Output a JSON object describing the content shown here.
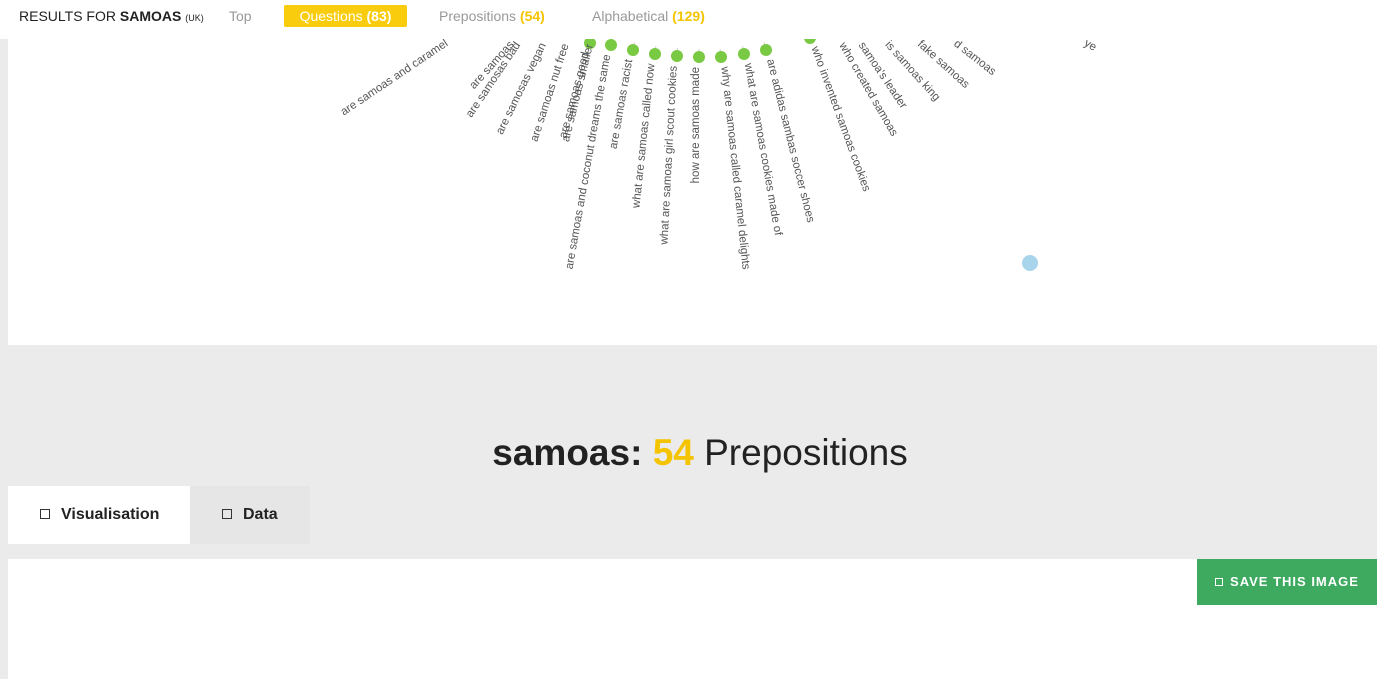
{
  "header": {
    "results_prefix": "RESULTS FOR",
    "keyword": "SAMOAS",
    "region": "(UK)",
    "tabs": [
      {
        "label": "Top",
        "count": ""
      },
      {
        "label": "Questions",
        "count": "(83)"
      },
      {
        "label": "Prepositions",
        "count": "(54)"
      },
      {
        "label": "Alphabetical",
        "count": "(129)"
      }
    ]
  },
  "colors": {
    "accent_yellow": "#f9cc0d",
    "node_green": "#7ac943",
    "node_blue": "#a8d4ec",
    "save_green": "#3daa5f"
  },
  "visualisation": {
    "labels": [
      "are samoas and caramel",
      "are samoas",
      "are samosas bad",
      "are samosas vegan",
      "are samoas nut free",
      "are samoas smaller",
      "are samoas good",
      "are samoas and coconut dreams the same",
      "are samoas racist",
      "what are samoas called now",
      "what are samoas girl scout cookies",
      "how are samoas made",
      "why are samoas called caramel delights",
      "what are samoas cookies made of",
      "are adidas sambas soccer shoes",
      "who invented samoas cookies",
      "who created samoas",
      "samoa's leader",
      "is samoas king",
      "fake samoas",
      "d samoas",
      "ye"
    ]
  },
  "section": {
    "keyword": "samoas:",
    "count": "54",
    "label": "Prepositions"
  },
  "view_tabs": {
    "visualisation": "Visualisation",
    "data": "Data"
  },
  "actions": {
    "save_image": "SAVE THIS IMAGE"
  }
}
